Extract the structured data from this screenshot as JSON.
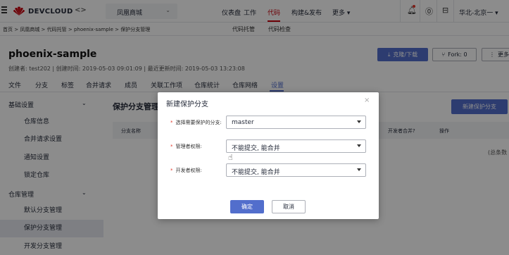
{
  "topbar": {
    "brand": "DEVCLOUD",
    "code_symbol": "<>",
    "project": "凤凰商城",
    "nav": [
      "仪表盘",
      "工作",
      "代码",
      "构建&发布",
      "更多 ▾"
    ],
    "region": "华北-北京一 ▾",
    "accent_color": "#c7000b"
  },
  "breadcrumb": {
    "path": "首页 > 凤凰商城 > 代码托管 > phoenix-sample > 保护分支管理",
    "sub_tabs": [
      "代码托管",
      "代码检查"
    ]
  },
  "repo": {
    "name": "phoenix-sample",
    "meta": "创建者: test202  |  创建时间: 2019-05-03 09:01:09  |  最近更新时间: 2019-05-03 13:23:08",
    "clone_label": "克隆/下载",
    "fork_label": "Fork: 0",
    "more_label": "更多",
    "tabs": [
      "文件",
      "分支",
      "标签",
      "合并请求",
      "成员",
      "关联工作项",
      "仓库统计",
      "仓库网络",
      "设置"
    ]
  },
  "sidebar": {
    "group1": "基础设置",
    "items1": [
      "仓库信息",
      "合并请求设置",
      "通知设置",
      "锁定仓库"
    ],
    "group2": "仓库管理",
    "items2": [
      "默认分支管理",
      "保护分支管理",
      "开发分支管理"
    ]
  },
  "main": {
    "title": "保护分支管理",
    "new_button": "新建保护分支",
    "columns": [
      "分支名称",
      "开发者合并?",
      "操作"
    ],
    "empty_text": "(总条数"
  },
  "dialog": {
    "title": "新建保护分支",
    "close": "×",
    "fields": [
      {
        "label": "选择需要保护的分支:",
        "value": "master"
      },
      {
        "label": "管理者权限:",
        "value": "不能提交, 能合并"
      },
      {
        "label": "开发者权限:",
        "value": "不能提交, 能合并"
      }
    ],
    "confirm": "确定",
    "cancel": "取消",
    "primary_color": "#526ecc"
  }
}
